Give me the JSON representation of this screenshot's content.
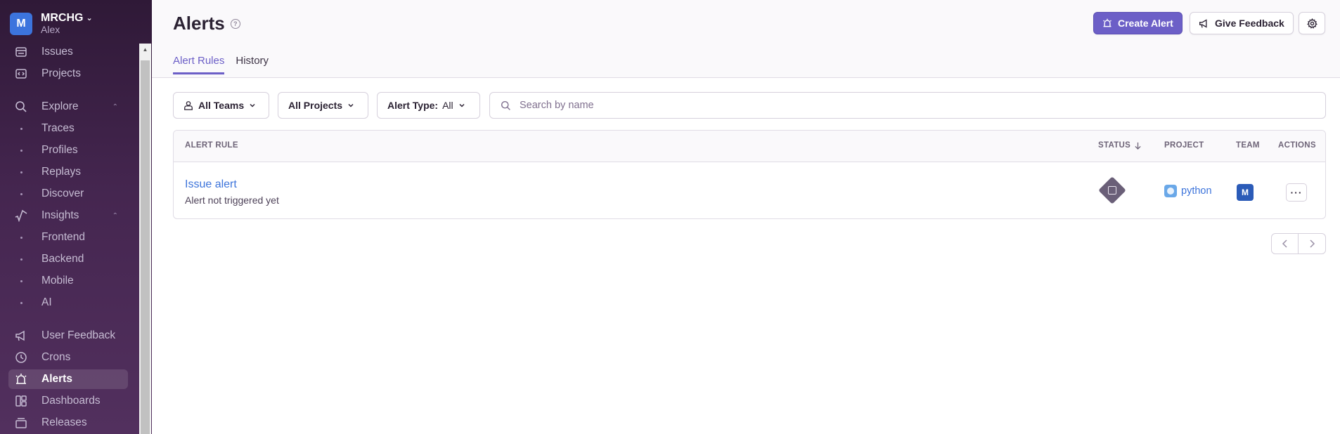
{
  "org": {
    "initial": "M",
    "name": "MRCHG",
    "user": "Alex"
  },
  "sidebar": {
    "items": [
      {
        "label": "Issues",
        "icon": "issues-icon"
      },
      {
        "label": "Projects",
        "icon": "projects-icon"
      },
      {
        "label": "Explore",
        "icon": "search-icon"
      },
      {
        "label": "Traces"
      },
      {
        "label": "Profiles"
      },
      {
        "label": "Replays"
      },
      {
        "label": "Discover"
      },
      {
        "label": "Insights",
        "icon": "insights-icon"
      },
      {
        "label": "Frontend"
      },
      {
        "label": "Backend"
      },
      {
        "label": "Mobile"
      },
      {
        "label": "AI"
      },
      {
        "label": "User Feedback",
        "icon": "megaphone-icon"
      },
      {
        "label": "Crons",
        "icon": "clock-icon"
      },
      {
        "label": "Alerts",
        "icon": "siren-icon",
        "active": true
      },
      {
        "label": "Dashboards",
        "icon": "dashboard-icon"
      },
      {
        "label": "Releases",
        "icon": "releases-icon"
      }
    ]
  },
  "header": {
    "title": "Alerts",
    "create_alert": "Create Alert",
    "give_feedback": "Give Feedback",
    "tabs": [
      "Alert Rules",
      "History"
    ]
  },
  "filters": {
    "teams": "All Teams",
    "projects": "All Projects",
    "alert_type_label": "Alert Type:",
    "alert_type_value": "All",
    "search_placeholder": "Search by name"
  },
  "table": {
    "columns": [
      "ALERT RULE",
      "STATUS",
      "PROJECT",
      "TEAM",
      "ACTIONS"
    ],
    "rows": [
      {
        "name": "Issue alert",
        "subtitle": "Alert not triggered yet",
        "project": "python",
        "team": "M"
      }
    ]
  },
  "colors": {
    "accent": "#6c5fc7",
    "link": "#3d74db",
    "sidebar": "#452650"
  }
}
